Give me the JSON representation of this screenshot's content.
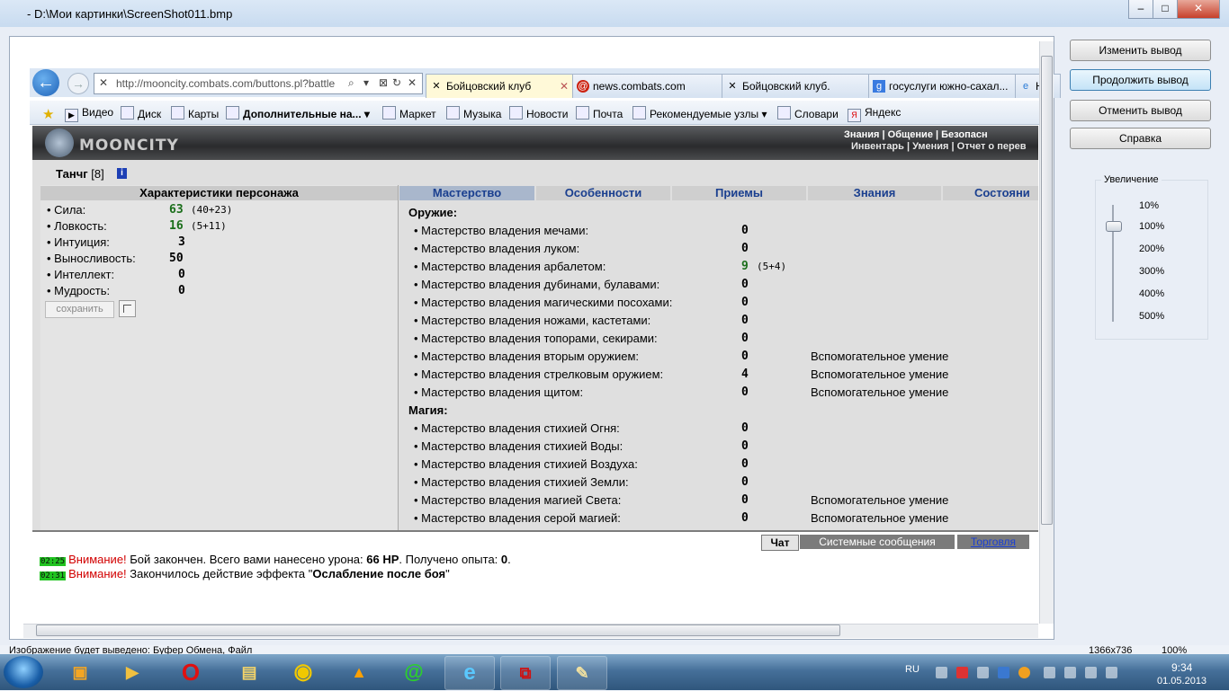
{
  "window": {
    "title": "- D:\\Мои картинки\\ScreenShot011.bmp",
    "min": "–",
    "max": "□",
    "close": "✕"
  },
  "side_buttons": {
    "change_output": "Изменить вывод",
    "continue_output": "Продолжить вывод",
    "cancel_output": "Отменить вывод",
    "help": "Справка"
  },
  "zoom": {
    "legend": "Увеличение",
    "levels": [
      "10%",
      "100%",
      "200%",
      "300%",
      "400%",
      "500%"
    ]
  },
  "browser": {
    "url": "http://mooncity.combats.com/buttons.pl?battle",
    "tabs": [
      {
        "label": "Бойцовский клуб",
        "close": "✕"
      },
      {
        "label": "news.combats.com"
      },
      {
        "label": "Бойцовский клуб."
      },
      {
        "label": "госуслуги южно-сахал..."
      },
      {
        "label": "Н"
      }
    ],
    "favorites": [
      "Видео",
      "Диск",
      "Карты",
      "Дополнительные на...",
      "Маркет",
      "Музыка",
      "Новости",
      "Почта",
      "Рекомендуемые узлы",
      "Словари",
      "Яндекс"
    ]
  },
  "game": {
    "logo": "MOONCITY",
    "nav_row1": "Знания | Общение | Безопасн",
    "nav_row2": "Инвентарь | Умения | Отчет о перев",
    "char_name": "Танчг",
    "char_level": "[8]",
    "info": "i",
    "left_title": "Характеристики персонажа",
    "stats": [
      {
        "label": "• Сила:",
        "value": "63",
        "extra": "(40+23)"
      },
      {
        "label": "• Ловкость:",
        "value": "16",
        "extra": "(5+11)"
      },
      {
        "label": "• Интуиция:",
        "value": "3",
        "extra": ""
      },
      {
        "label": "• Выносливость:",
        "value": "50",
        "extra": ""
      },
      {
        "label": "• Интеллект:",
        "value": "0",
        "extra": ""
      },
      {
        "label": "• Мудрость:",
        "value": "0",
        "extra": ""
      }
    ],
    "save_label": "сохранить",
    "tabs": [
      "Мастерство",
      "Особенности",
      "Приемы",
      "Знания",
      "Состояни"
    ],
    "weapons_title": "Оружие:",
    "weapons": [
      {
        "label": "• Мастерство владения мечами:",
        "value": "0",
        "extra": "",
        "note": ""
      },
      {
        "label": "• Мастерство владения луком:",
        "value": "0",
        "extra": "",
        "note": ""
      },
      {
        "label": "• Мастерство владения арбалетом:",
        "value": "9",
        "extra": "(5+4)",
        "note": ""
      },
      {
        "label": "• Мастерство владения дубинами, булавами:",
        "value": "0",
        "extra": "",
        "note": ""
      },
      {
        "label": "• Мастерство владения магическими посохами:",
        "value": "0",
        "extra": "",
        "note": ""
      },
      {
        "label": "• Мастерство владения ножами, кастетами:",
        "value": "0",
        "extra": "",
        "note": ""
      },
      {
        "label": "• Мастерство владения топорами, секирами:",
        "value": "0",
        "extra": "",
        "note": ""
      },
      {
        "label": "• Мастерство владения вторым оружием:",
        "value": "0",
        "extra": "",
        "note": "Вспомогательное умение"
      },
      {
        "label": "• Мастерство владения стрелковым оружием:",
        "value": "4",
        "extra": "",
        "note": "Вспомогательное умение"
      },
      {
        "label": "• Мастерство владения щитом:",
        "value": "0",
        "extra": "",
        "note": "Вспомогательное умение"
      }
    ],
    "magic_title": "Магия:",
    "magic": [
      {
        "label": "• Мастерство владения стихией Огня:",
        "value": "0",
        "note": ""
      },
      {
        "label": "• Мастерство владения стихией Воды:",
        "value": "0",
        "note": ""
      },
      {
        "label": "• Мастерство владения стихией Воздуха:",
        "value": "0",
        "note": ""
      },
      {
        "label": "• Мастерство владения стихией Земли:",
        "value": "0",
        "note": ""
      },
      {
        "label": "• Мастерство владения магией Света:",
        "value": "0",
        "note": "Вспомогательное умение"
      },
      {
        "label": "• Мастерство владения серой магией:",
        "value": "0",
        "note": "Вспомогательное умение"
      }
    ]
  },
  "chat": {
    "tabs": [
      "Чат",
      "Системные сообщения",
      "Торговля"
    ],
    "lines": [
      {
        "time": "02:25",
        "warn": "Внимание!",
        "text": " Бой закончен. Всего вами нанесено урона: ",
        "b1": "66 HP",
        "text2": ". Получено опыта: ",
        "b2": "0",
        "text3": "."
      },
      {
        "time": "02:31",
        "warn": "Внимание!",
        "text": " Закончилось действие эффекта \"",
        "b1": "Ослабление после боя",
        "text2": "\"",
        "b2": "",
        "text3": ""
      }
    ]
  },
  "status": {
    "left": "Изображение будет выведено:  Буфер Обмена, Файл",
    "size": "1366x736",
    "zoom": "100%"
  },
  "taskbar": {
    "lang": "RU",
    "time": "9:34",
    "date": "01.05.2013"
  }
}
